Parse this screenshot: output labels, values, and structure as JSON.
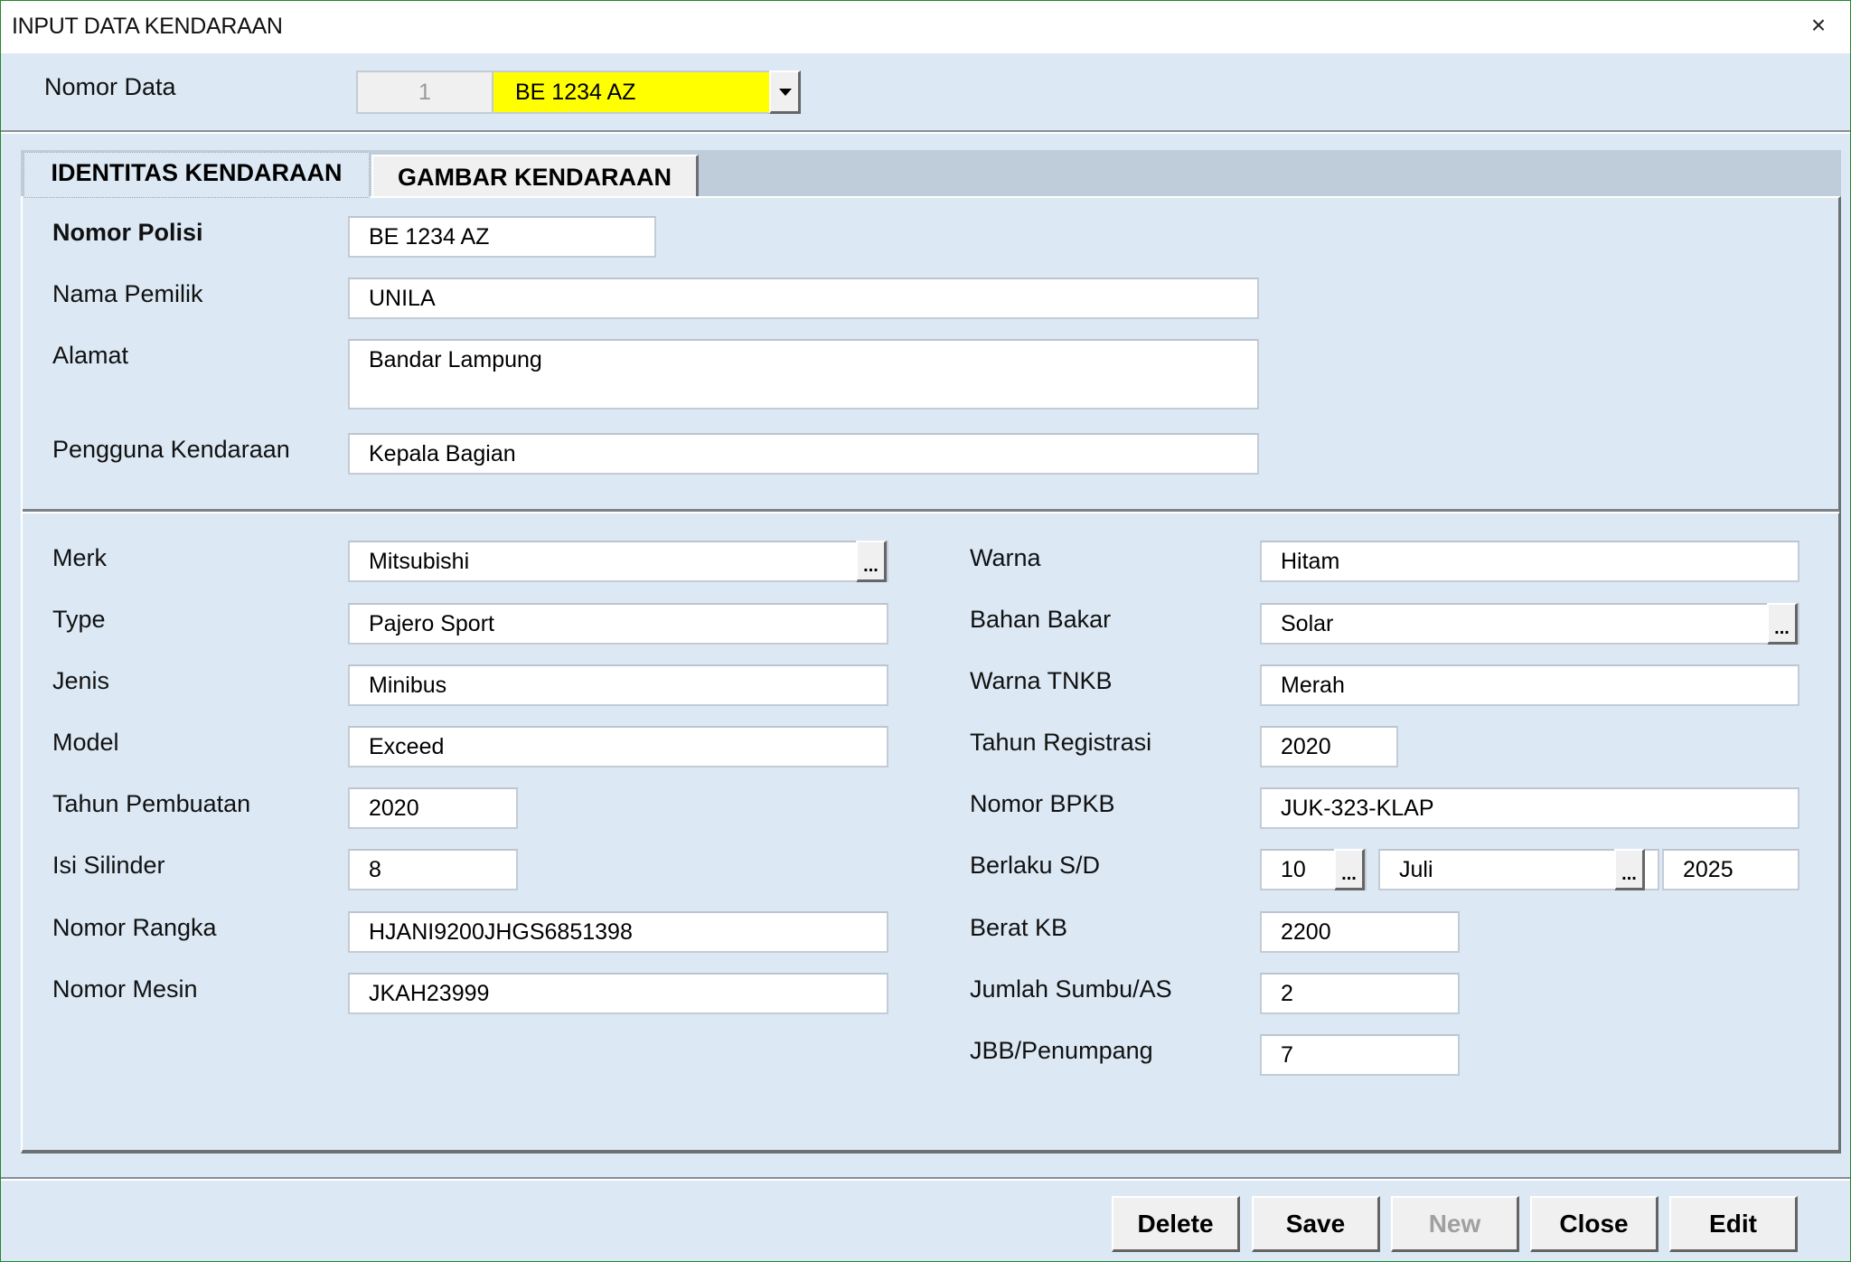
{
  "window": {
    "title": "INPUT DATA KENDARAAN",
    "close_icon": "×"
  },
  "record_selector": {
    "label": "Nomor Data",
    "index": "1",
    "selected_value": "BE 1234 AZ",
    "highlight_color": "#ffff00"
  },
  "tabs": [
    {
      "label": "IDENTITAS KENDARAAN",
      "active": true
    },
    {
      "label": "GAMBAR KENDARAAN",
      "active": false
    }
  ],
  "owner_section": {
    "nomor_polisi": {
      "label": "Nomor Polisi",
      "value": "BE 1234 AZ"
    },
    "nama_pemilik": {
      "label": "Nama Pemilik",
      "value": "UNILA"
    },
    "alamat": {
      "label": "Alamat",
      "value": "Bandar Lampung"
    },
    "pengguna": {
      "label": "Pengguna Kendaraan",
      "value": "Kepala Bagian"
    }
  },
  "vehicle_left": {
    "merk": {
      "label": "Merk",
      "value": "Mitsubishi"
    },
    "type": {
      "label": "Type",
      "value": "Pajero Sport"
    },
    "jenis": {
      "label": "Jenis",
      "value": "Minibus"
    },
    "model": {
      "label": "Model",
      "value": "Exceed"
    },
    "tahun_pembuatan": {
      "label": "Tahun Pembuatan",
      "value": "2020"
    },
    "isi_silinder": {
      "label": "Isi Silinder",
      "value": "8"
    },
    "nomor_rangka": {
      "label": "Nomor Rangka",
      "value": "HJANI9200JHGS6851398"
    },
    "nomor_mesin": {
      "label": "Nomor Mesin",
      "value": "JKAH23999"
    }
  },
  "vehicle_right": {
    "warna": {
      "label": "Warna",
      "value": "Hitam"
    },
    "bahan_bakar": {
      "label": "Bahan Bakar",
      "value": "Solar"
    },
    "warna_tnkb": {
      "label": "Warna TNKB",
      "value": "Merah"
    },
    "tahun_registrasi": {
      "label": "Tahun Registrasi",
      "value": "2020"
    },
    "nomor_bpkb": {
      "label": "Nomor BPKB",
      "value": "JUK-323-KLAP"
    },
    "berlaku": {
      "label": "Berlaku S/D",
      "day": "10",
      "month": "Juli",
      "year": "2025"
    },
    "berat_kb": {
      "label": "Berat KB",
      "value": "2200"
    },
    "jumlah_sumbu": {
      "label": "Jumlah Sumbu/AS",
      "value": "2"
    },
    "jbb": {
      "label": "JBB/Penumpang",
      "value": "7"
    }
  },
  "picker_button_label": "...",
  "buttons": {
    "delete": "Delete",
    "save": "Save",
    "new": "New",
    "close": "Close",
    "edit": "Edit"
  }
}
